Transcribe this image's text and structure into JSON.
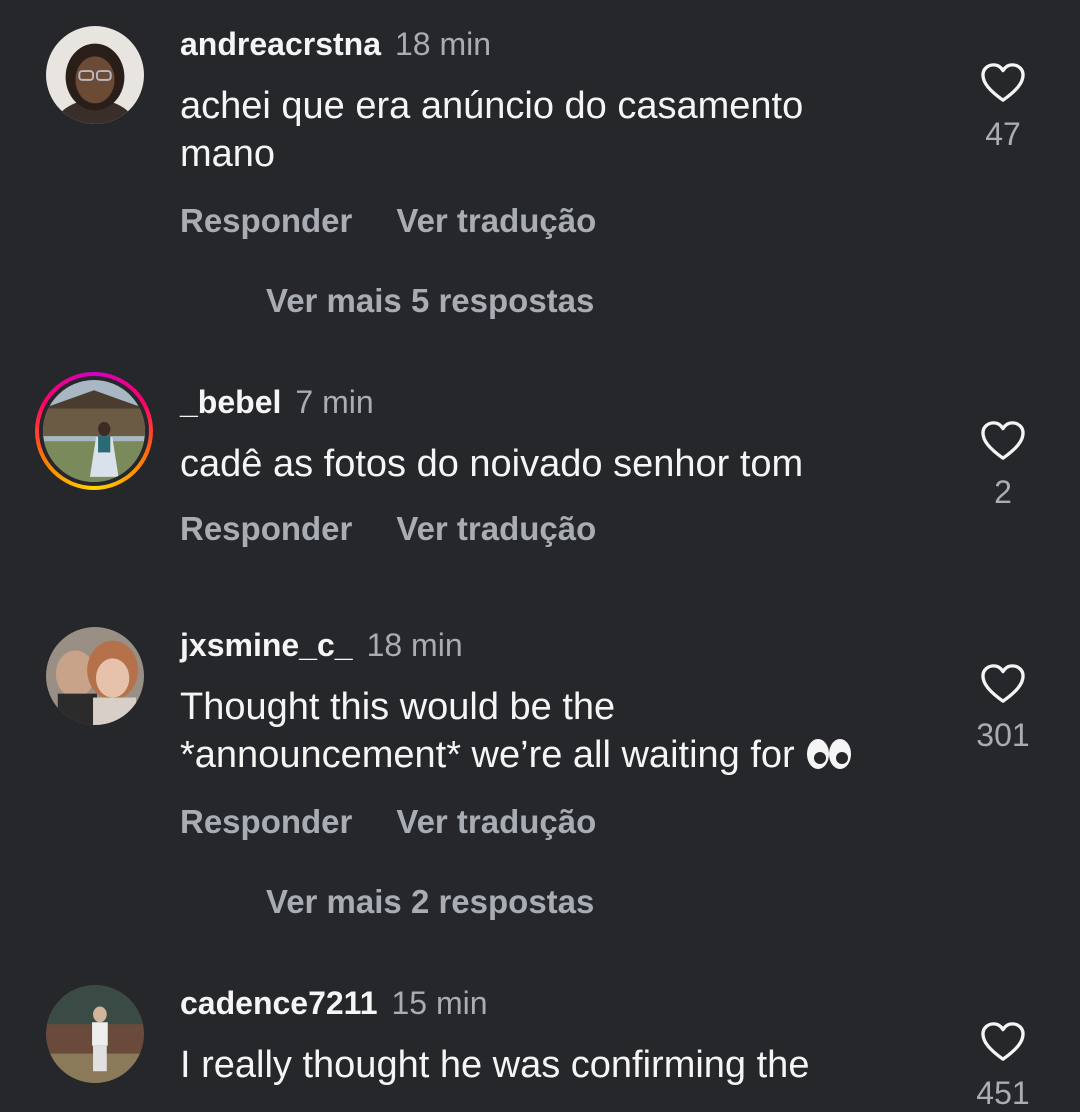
{
  "comments": [
    {
      "username": "andreacrstna",
      "time": "18 min",
      "text": "achei que era anúncio do casamento mano",
      "reply_label": "Responder",
      "translate_label": "Ver tradução",
      "likes": "47",
      "more_replies": "Ver mais 5 respostas"
    },
    {
      "username": "_bebel",
      "time": "7 min",
      "text": "cadê as fotos do noivado senhor tom",
      "reply_label": "Responder",
      "translate_label": "Ver tradução",
      "likes": "2"
    },
    {
      "username": "jxsmine_c_",
      "time": "18 min",
      "text_line1": "Thought this would be the",
      "text_line2": "*announcement* we’re all waiting for",
      "reply_label": "Responder",
      "translate_label": "Ver tradução",
      "likes": "301",
      "more_replies": "Ver mais 2 respostas"
    },
    {
      "username": "cadence7211",
      "time": "15 min",
      "text": "I really thought he was confirming the",
      "likes": "451"
    }
  ],
  "colors": {
    "background": "#25272b",
    "primary_text": "#f5f5f5",
    "secondary_text": "#a8acb3"
  },
  "icons": {
    "like": "heart-outline-icon",
    "emoji": "eyes-emoji"
  }
}
